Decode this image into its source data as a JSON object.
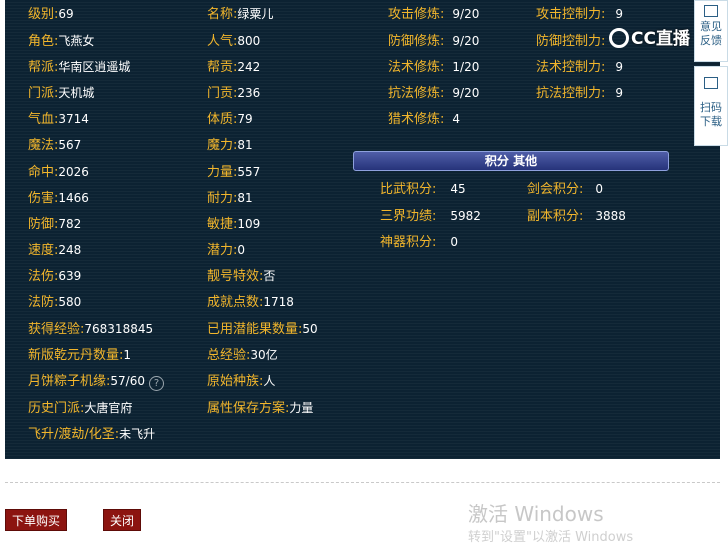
{
  "col1": [
    {
      "label": "级别:",
      "value": "69"
    },
    {
      "label": "角色:",
      "value": "飞燕女"
    },
    {
      "label": "帮派:",
      "value": "华南区逍遥城"
    },
    {
      "label": "门派:",
      "value": "天机城"
    },
    {
      "label": "气血:",
      "value": "3714"
    },
    {
      "label": "魔法:",
      "value": "567"
    },
    {
      "label": "命中:",
      "value": "2026"
    },
    {
      "label": "伤害:",
      "value": "1466"
    },
    {
      "label": "防御:",
      "value": "782"
    },
    {
      "label": "速度:",
      "value": "248"
    },
    {
      "label": "法伤:",
      "value": "639"
    },
    {
      "label": "法防:",
      "value": "580"
    },
    {
      "label": "获得经验:",
      "value": "768318845"
    },
    {
      "label": "新版乾元丹数量:",
      "value": "1"
    },
    {
      "label": "月饼粽子机缘:",
      "value": "57/60"
    },
    {
      "label": "历史门派:",
      "value": "大唐官府"
    },
    {
      "label": "飞升/渡劫/化圣:",
      "value": "未飞升"
    }
  ],
  "help_glyph": "?",
  "col2": [
    {
      "label": "名称:",
      "value": "绿粟儿"
    },
    {
      "label": "人气:",
      "value": "800"
    },
    {
      "label": "帮贡:",
      "value": "242"
    },
    {
      "label": "门贡:",
      "value": "236"
    },
    {
      "label": "体质:",
      "value": "79"
    },
    {
      "label": "魔力:",
      "value": "81"
    },
    {
      "label": "力量:",
      "value": "557"
    },
    {
      "label": "耐力:",
      "value": "81"
    },
    {
      "label": "敏捷:",
      "value": "109"
    },
    {
      "label": "潜力:",
      "value": "0"
    },
    {
      "label": "靓号特效:",
      "value": "否"
    },
    {
      "label": "成就点数:",
      "value": "1718"
    },
    {
      "label": "已用潜能果数量:",
      "value": "50"
    },
    {
      "label": "总经验:",
      "value": "30亿"
    },
    {
      "label": "原始种族:",
      "value": "人"
    },
    {
      "label": "属性保存方案:",
      "value": "力量"
    }
  ],
  "cultivation": [
    {
      "label": "攻击修炼:",
      "value": "9/20"
    },
    {
      "label": "防御修炼:",
      "value": "9/20"
    },
    {
      "label": "法术修炼:",
      "value": "1/20"
    },
    {
      "label": "抗法修炼:",
      "value": "9/20"
    },
    {
      "label": "猎术修炼:",
      "value": "4"
    }
  ],
  "control": [
    {
      "label": "攻击控制力:",
      "value": "9"
    },
    {
      "label": "防御控制力:",
      "value": ""
    },
    {
      "label": "法术控制力:",
      "value": "9"
    },
    {
      "label": "抗法控制力:",
      "value": "9"
    }
  ],
  "section_title": "积分 其他",
  "points": [
    {
      "label": "比武积分:",
      "value": "45"
    },
    {
      "label": "剑会积分:",
      "value": "0"
    },
    {
      "label": "三界功绩:",
      "value": "5982"
    },
    {
      "label": "副本积分:",
      "value": "3888"
    },
    {
      "label": "神器积分:",
      "value": "0"
    }
  ],
  "overlay": {
    "logo": "CC直播",
    "feedback_label": "意见反馈",
    "scan_label": "扫码下载"
  },
  "buttons": {
    "buy": "下单购买",
    "close": "关闭"
  },
  "watermark": {
    "line1": "激活 Windows",
    "line2": "转到\"设置\"以激活 Windows"
  }
}
